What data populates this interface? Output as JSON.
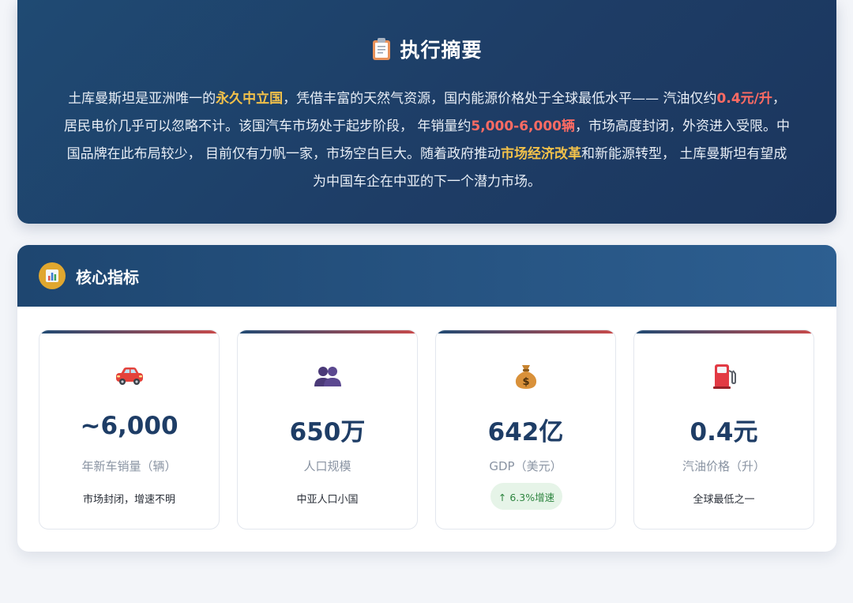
{
  "summary": {
    "icon": "clipboard-icon",
    "title": "执行摘要",
    "segments": [
      {
        "text": "土库曼斯坦是亚洲唯一的",
        "style": "plain"
      },
      {
        "text": "永久中立国",
        "style": "gold"
      },
      {
        "text": "，凭借丰富的天然气资源，国内能源价格处于全球最低水平—— 汽油仅约",
        "style": "plain"
      },
      {
        "text": "0.4元/升",
        "style": "red"
      },
      {
        "text": "，居民电价几乎可以忽略不计。该国汽车市场处于起步阶段， 年销量约",
        "style": "plain"
      },
      {
        "text": "5,000-6,000辆",
        "style": "red"
      },
      {
        "text": "，市场高度封闭，外资进入受限。中国品牌在此布局较少， 目前仅有力帆一家，市场空白巨大。随着政府推动",
        "style": "plain"
      },
      {
        "text": "市场经济改革",
        "style": "gold"
      },
      {
        "text": "和新能源转型， 土库曼斯坦有望成为中国车企在中亚的下一个潜力市场。",
        "style": "plain"
      }
    ]
  },
  "metrics": {
    "icon": "bar-chart-icon",
    "title": "核心指标",
    "cards": [
      {
        "icon": "car-icon",
        "value": "~6,000",
        "label": "年新车销量（辆）",
        "note": "市场封闭，增速不明"
      },
      {
        "icon": "people-icon",
        "value": "650万",
        "label": "人口规模",
        "note": "中亚人口小国"
      },
      {
        "icon": "money-bag-icon",
        "value": "642亿",
        "label": "GDP（美元）",
        "badge": "↑ 6.3%增速"
      },
      {
        "icon": "fuel-pump-icon",
        "value": "0.4元",
        "label": "汽油价格（升）",
        "note": "全球最低之一"
      }
    ]
  },
  "colors": {
    "navy": "#1e3d66",
    "gold_highlight": "#f2c14a",
    "red_highlight": "#ff6b63",
    "growth_green": "#2e8540"
  }
}
